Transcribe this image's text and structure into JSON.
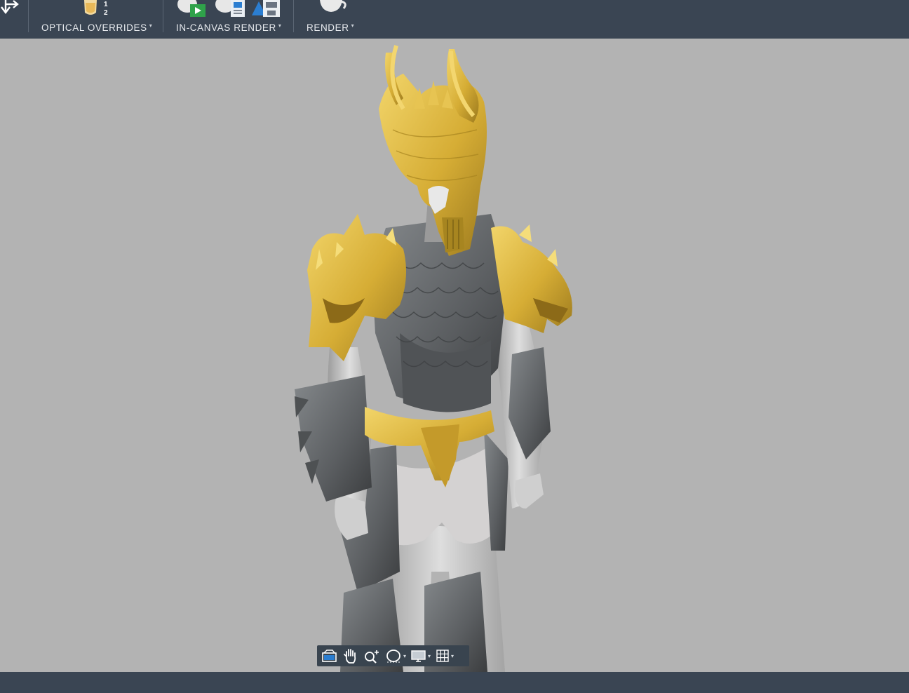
{
  "toolbar": {
    "groups": [
      {
        "label": "OPTICAL OVERRIDES",
        "icon": "optical-overrides-icon",
        "icon_numbers": [
          "1",
          "2"
        ]
      },
      {
        "label": "IN-CANVAS RENDER",
        "icon": "in-canvas-render-icon"
      },
      {
        "label": "RENDER",
        "icon": "render-teapot-icon"
      }
    ],
    "dropdown_caret": "▾"
  },
  "viewport": {
    "background": "#b3b3b3",
    "model": "armored-character-model",
    "gold_color": "#d9b23a",
    "armor_color": "#5e6163",
    "body_color": "#c9c9c9"
  },
  "navbar": {
    "tools": [
      "camera-icon",
      "pan-hand-icon",
      "zoom-icon",
      "orbit-icon",
      "display-mode-icon",
      "grid-icon"
    ]
  },
  "colors": {
    "chrome": "#3a4553",
    "chrome_text": "#e8ebef"
  }
}
